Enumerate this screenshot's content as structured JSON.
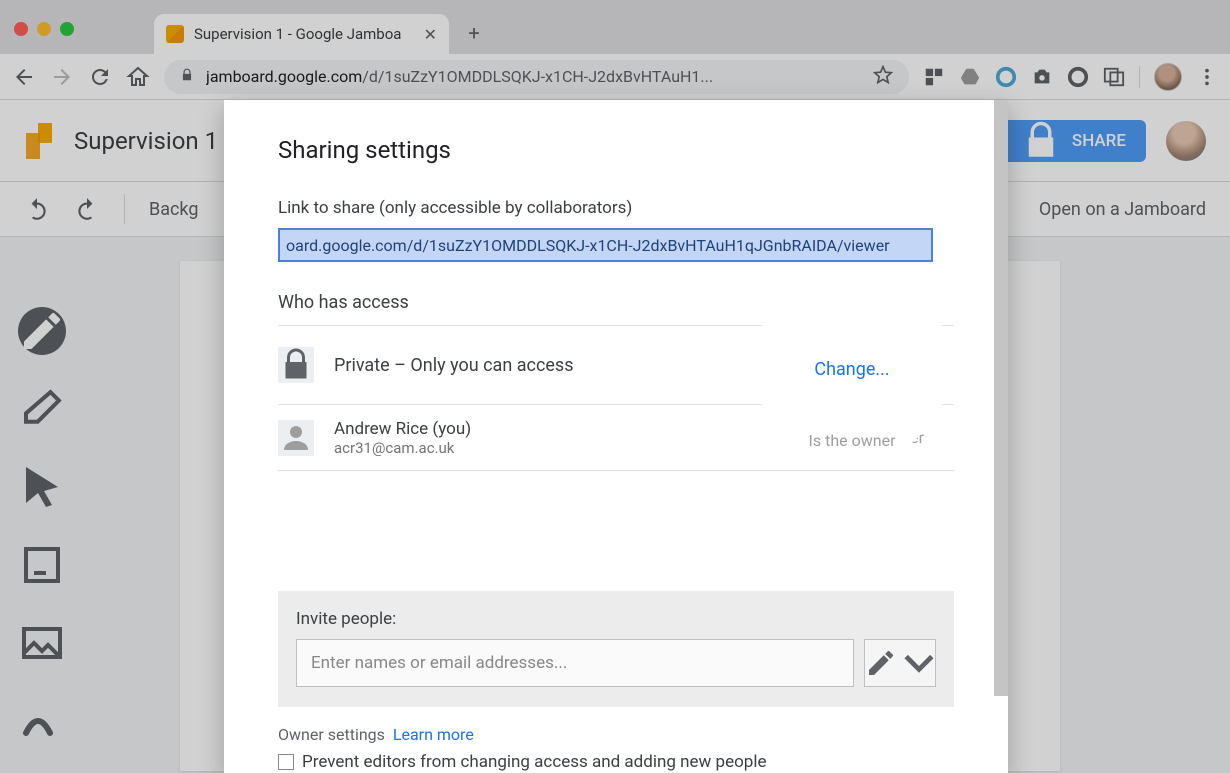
{
  "browser": {
    "tab_title": "Supervision 1 - Google Jamboa",
    "url_host": "jamboard.google.com",
    "url_path": "/d/1suZzY1OMDDLSQKJ-x1CH-J2dxBvHTAuH1...",
    "new_tab": "+"
  },
  "app": {
    "doc_title": "Supervision 1",
    "share_label": "SHARE",
    "background_label": "Backg",
    "open_label": "Open on a Jamboard"
  },
  "modal": {
    "title": "Sharing settings",
    "link_label": "Link to share (only accessible by collaborators)",
    "link_value": "oard.google.com/d/1suZzY1OMDDLSQKJ-x1CH-J2dxBvHTAuH1qJGnbRAIDA/viewer",
    "access_title": "Who has access",
    "access_text": "Private – Only you can access",
    "change_label": "Change...",
    "owner_name": "Andrew Rice (you)",
    "owner_email": "acr31@cam.ac.uk",
    "owner_role": "Is the owner",
    "invite_label": "Invite people:",
    "invite_placeholder": "Enter names or email addresses...",
    "owner_settings_label": "Owner settings",
    "learn_more": "Learn more",
    "checkbox_label": "Prevent editors from changing access and adding new people"
  }
}
